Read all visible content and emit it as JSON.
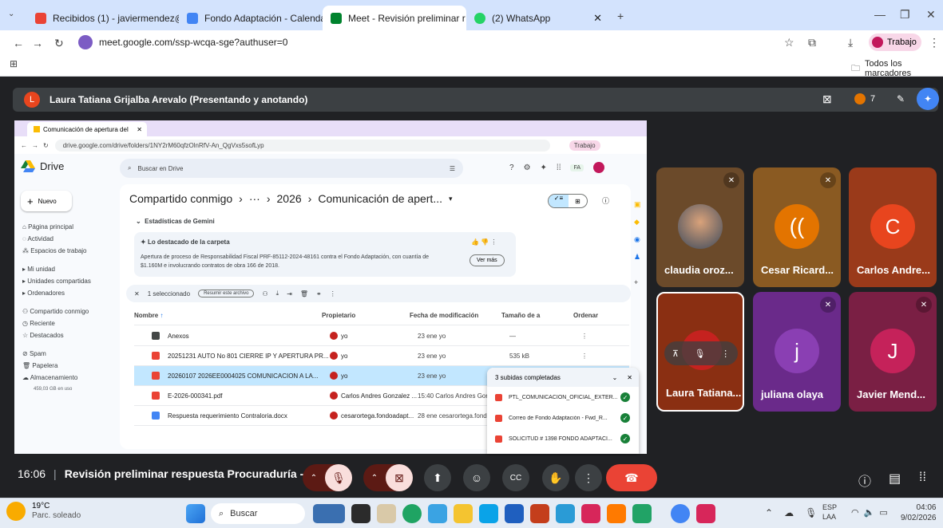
{
  "browser": {
    "tabs": [
      {
        "label": "Recibidos (1) - javiermendez@f",
        "active": false
      },
      {
        "label": "Fondo Adaptación - Calendar -",
        "active": false
      },
      {
        "label": "Meet - Revisión preliminar r",
        "active": true
      },
      {
        "label": "(2) WhatsApp",
        "active": false
      }
    ],
    "url": "meet.google.com/ssp-wcqa-sge?authuser=0",
    "profile_label": "Trabajo",
    "bookmarks_label": "Todos los marcadores"
  },
  "meet": {
    "presenter_initial": "L",
    "presenter_label": "Laura Tatiana Grijalba Arevalo (Presentando y anotando)",
    "participants_count": "7",
    "meeting_time": "16:06",
    "meeting_title": "Revisión preliminar respuesta Procuraduría - Re...",
    "tiles": [
      {
        "name": "claudia oroz...",
        "initial": "",
        "color": "#6b4a2a"
      },
      {
        "name": "Cesar Ricard...",
        "initial": "",
        "color": "#8a5a22"
      },
      {
        "name": "Carlos Andre...",
        "initial": "C",
        "color": "#9a3a1a"
      },
      {
        "name": "Laura Tatiana...",
        "initial": "",
        "color": "#8a2f12"
      },
      {
        "name": "juliana olaya",
        "initial": "j",
        "color": "#6a2a8a"
      },
      {
        "name": "Javier Mend...",
        "initial": "J",
        "color": "#7a1f44"
      }
    ]
  },
  "drive": {
    "tab_label": "Comunicación de apertura del",
    "url": "drive.google.com/drive/folders/1NY2rM60qfzOlnRfV-An_QgVxs5sofLyp",
    "profile_label": "Trabajo",
    "logo_label": "Drive",
    "search_placeholder": "Buscar en Drive",
    "new_label": "Nuevo",
    "nav": [
      "Página principal",
      "Actividad",
      "Espacios de trabajo",
      "Mi unidad",
      "Unidades compartidas",
      "Ordenadores",
      "Compartido conmigo",
      "Reciente",
      "Destacados",
      "Spam",
      "Papelera",
      "Almacenamiento"
    ],
    "storage": "459,03 GB en uso",
    "breadcrumb": [
      "Compartido conmigo",
      "›",
      "···",
      "›",
      "2026",
      "›",
      "Comunicación de apert..."
    ],
    "gemini_title": "Estadísticas de Gemini",
    "highlight_title": "Lo destacado de la carpeta",
    "highlight_text": "Apertura de proceso de Responsabilidad Fiscal PRF-85112-2024-48161 contra el Fondo Adaptación, con cuantía de $1.160M e involucrando contratos de obra 166 de 2018.",
    "ver_mas": "Ver más",
    "selected_label": "1 seleccionado",
    "summarize_label": "Resumir este archivo",
    "columns": [
      "Nombre",
      "Propietario",
      "Fecha de modificación",
      "Tamaño de a",
      "Ordenar"
    ],
    "files": [
      {
        "name": "Anexos",
        "owner": "yo",
        "date": "23 ene yo",
        "size": "—",
        "color": "#444746"
      },
      {
        "name": "20251231 AUTO No 801 CIERRE IP Y APERTURA PR...",
        "owner": "yo",
        "date": "23 ene yo",
        "size": "535 kB",
        "color": "#ea4335"
      },
      {
        "name": "20260107 2026EE0004025 COMUNICACION A LA...",
        "owner": "yo",
        "date": "23 ene yo",
        "size": "",
        "color": "#ea4335"
      },
      {
        "name": "E-2026-000341.pdf",
        "owner": "Carlos Andres Gonzalez ...",
        "date": "15:40 Carlos Andres Gonzalez",
        "size": "",
        "color": "#ea4335"
      },
      {
        "name": "Respuesta requerimiento Contraloria.docx",
        "owner": "cesarortega.fondoadapt...",
        "date": "28 ene cesarortega.fondoadap",
        "size": "",
        "color": "#4285f4"
      }
    ],
    "uploads_title": "3 subidas completadas",
    "uploads": [
      "PTL_COMUNICACION_OFICIAL_EXTER...",
      "Correo de Fondo Adaptación - Fwd_R...",
      "SOLICITUD # 1398 FONDO ADAPTACI..."
    ]
  },
  "taskbar": {
    "weather_temp": "19°C",
    "weather_desc": "Parc. soleado",
    "search_label": "Buscar",
    "lang_top": "ESP",
    "lang_bottom": "LAA",
    "time": "04:06",
    "date": "9/02/2026"
  },
  "colors": {
    "meet_bg": "#202124",
    "end_call": "#ea4335",
    "mic_off": "#f9dedc",
    "accent": "#1a73e8"
  }
}
